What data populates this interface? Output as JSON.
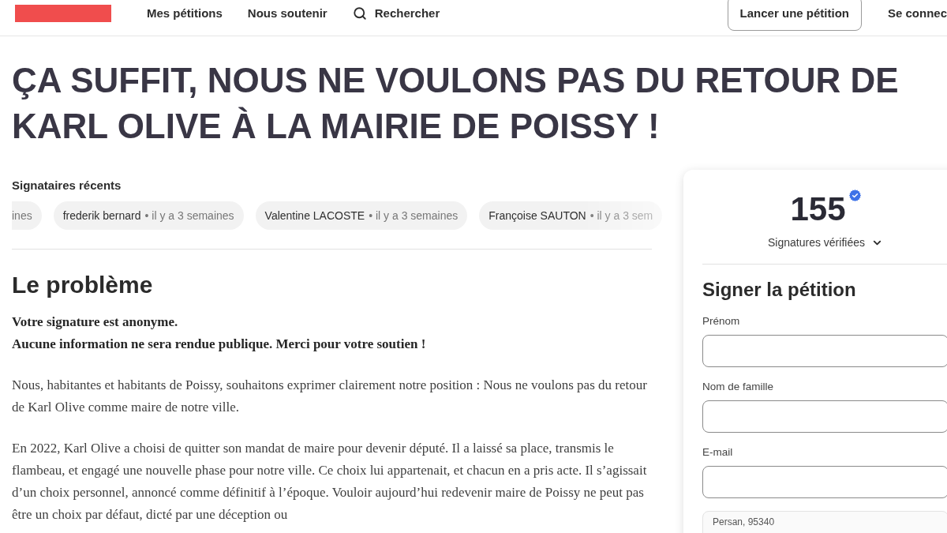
{
  "header": {
    "nav": [
      {
        "kind": "link",
        "label": "Mes pétitions"
      },
      {
        "kind": "link",
        "label": "Nous soutenir"
      },
      {
        "kind": "search",
        "label": "Rechercher"
      }
    ],
    "start_button": "Lancer une pétition",
    "login_link": "Se connec"
  },
  "title": "ÇA SUFFIT, NOUS NE VOULONS PAS DU RETOUR DE KARL OLIVE À LA MAIRIE DE POISSY !",
  "recent_signers": {
    "heading": "Signataires récents",
    "items": [
      {
        "time": "ines"
      },
      {
        "name": "frederik bernard",
        "time": "• il y a 3 semaines"
      },
      {
        "name": "Valentine LACOSTE",
        "time": "• il y a 3 semaines"
      },
      {
        "name": "Françoise SAUTON",
        "time": "• il y a 3 sem"
      }
    ]
  },
  "problem": {
    "heading": "Le problème",
    "notice": [
      "Votre signature est anonyme.",
      "Aucune information ne sera rendue publique. Merci pour votre soutien !"
    ],
    "paragraphs": [
      "Nous, habitantes et habitants de Poissy, souhaitons exprimer clairement notre position : Nous ne voulons pas du retour de Karl Olive comme maire de notre ville.",
      "En 2022, Karl Olive a choisi de quitter son mandat de maire pour devenir député. Il a laissé sa place, transmis le flambeau, et engagé une nouvelle phase pour notre ville. Ce choix lui appartenait, et chacun en a pris acte. Il s’agissait d’un choix personnel, annoncé comme définitif à l’époque. Vouloir aujourd’hui redevenir maire de Poissy ne peut pas être un choix par défaut, dicté par une déception ou"
    ]
  },
  "sign_card": {
    "count": "155",
    "verified": true,
    "count_label": "Signatures vérifiées",
    "heading": "Signer la pétition",
    "fields": [
      {
        "kind": "input",
        "label": "Prénom"
      },
      {
        "kind": "input",
        "label": "Nom de famille"
      },
      {
        "kind": "input",
        "label": "E-mail"
      },
      {
        "kind": "location",
        "value": "Persan, 95340"
      }
    ]
  }
}
